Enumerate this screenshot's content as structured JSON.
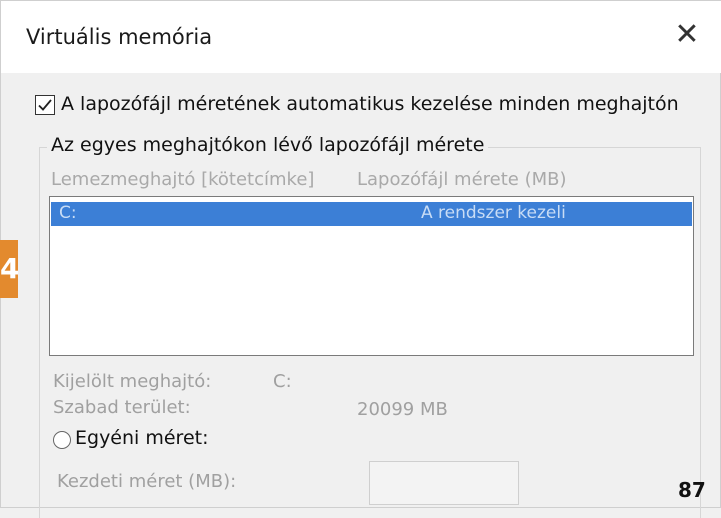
{
  "window": {
    "title": "Virtuális memória",
    "close_glyph": "✕"
  },
  "auto_manage": {
    "label": "A lapozófájl méretének automatikus kezelése minden meghajtón",
    "checked": true
  },
  "group": {
    "title": "Az egyes meghajtókon lévő lapozófájl mérete",
    "columns": [
      "Lemezmeghajtó [kötetcímke]",
      "Lapozófájl mérete (MB)"
    ],
    "rows": [
      {
        "drive": "C:",
        "size": "A rendszer kezeli",
        "selected": true
      }
    ]
  },
  "details": {
    "selected_drive_label": "Kijelölt meghajtó:",
    "selected_drive_value": "C:",
    "free_space_label": "Szabad terület:",
    "free_space_value": "20099 MB"
  },
  "custom_size": {
    "label": "Egyéni méret:",
    "selected": false,
    "initial_label": "Kezdeti méret (MB):",
    "initial_value": ""
  },
  "overlay": {
    "badge_text": "4",
    "page_number": "87",
    "badge_color": "#e38a2e"
  }
}
